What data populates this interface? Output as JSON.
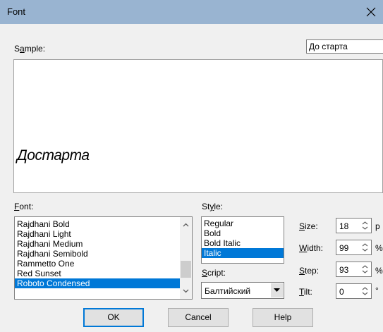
{
  "window": {
    "title": "Font"
  },
  "sample": {
    "label_pre": "S",
    "label_ul": "a",
    "label_post": "mple:",
    "input_value": "До старта",
    "preview_text": "Достарта"
  },
  "font": {
    "label_pre": "",
    "label_ul": "F",
    "label_post": "ont:",
    "items": [
      "Rajdhani Bold",
      "Rajdhani Light",
      "Rajdhani Medium",
      "Rajdhani Semibold",
      "Rammetto One",
      "Red Sunset",
      "Roboto Condensed"
    ],
    "selected_index": 6
  },
  "style": {
    "label_pre": "St",
    "label_ul": "y",
    "label_post": "le:",
    "items": [
      "Regular",
      "Bold",
      "Bold Italic",
      "Italic"
    ],
    "selected_index": 3
  },
  "script": {
    "label_pre": "",
    "label_ul": "S",
    "label_post": "cript:",
    "value": "Балтийский"
  },
  "size": {
    "label_pre": "",
    "label_ul": "S",
    "label_post": "ize:",
    "value": "18",
    "unit": "p"
  },
  "width": {
    "label_pre": "",
    "label_ul": "W",
    "label_post": "idth:",
    "value": "99",
    "unit": "%"
  },
  "step": {
    "label_pre": "",
    "label_ul": "S",
    "label_post": "tep:",
    "value": "93",
    "unit": "%"
  },
  "tilt": {
    "label_pre": "",
    "label_ul": "T",
    "label_post": "ilt:",
    "value": "0",
    "unit": "°"
  },
  "buttons": {
    "ok": "OK",
    "cancel": "Cancel",
    "help": "Help"
  },
  "colors": {
    "titlebar": "#99b4d1",
    "selection": "#0078d7",
    "dialog_bg": "#f0f0f0"
  }
}
